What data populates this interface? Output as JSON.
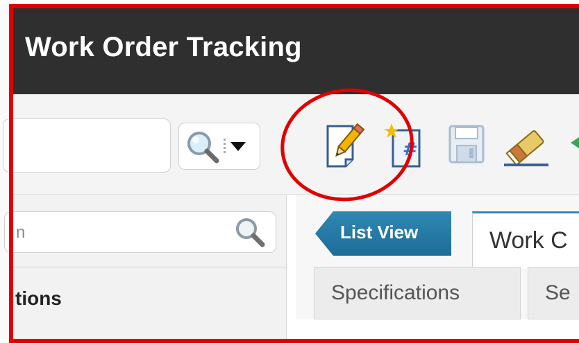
{
  "app": {
    "title": "Work Order Tracking"
  },
  "toolbar": {
    "search_value": "",
    "icons": [
      {
        "name": "edit-pencil-icon",
        "label": ""
      },
      {
        "name": "new-record-icon",
        "label": ""
      },
      {
        "name": "save-disk-icon",
        "label": ""
      },
      {
        "name": "clear-eraser-icon",
        "label": ""
      }
    ]
  },
  "left_panel": {
    "search_text": "n",
    "section_heading": "tions"
  },
  "tabs": {
    "list_view": "List View",
    "work_order": "Work C",
    "subtabs": [
      "Specifications",
      "Se"
    ]
  },
  "annotation": {
    "frame_color": "#e00000",
    "circle_color": "#e00000"
  }
}
